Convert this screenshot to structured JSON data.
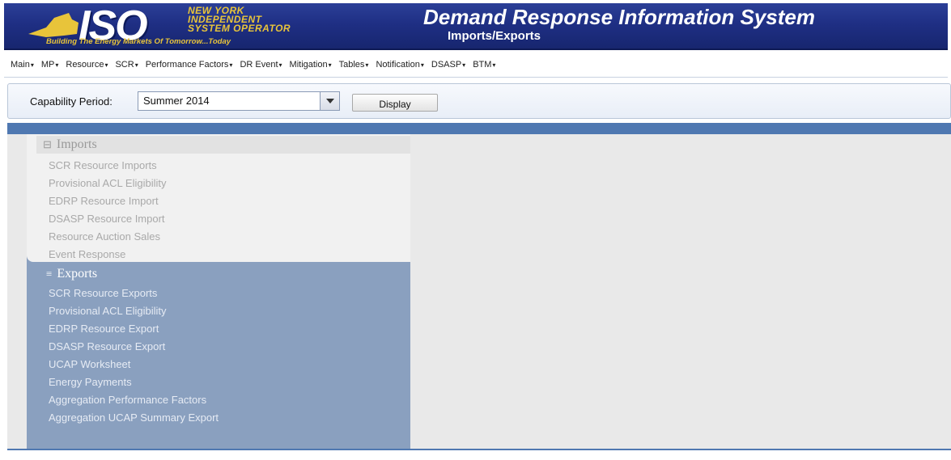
{
  "header": {
    "logo_text": "ISO",
    "org_lines": [
      "NEW YORK",
      "INDEPENDENT",
      "SYSTEM OPERATOR"
    ],
    "tagline": "Building The Energy Markets Of Tomorrow...Today",
    "app_title": "Demand Response Information System",
    "page_subtitle": "Imports/Exports",
    "brand_gold": "#e8c43a",
    "brand_blue": "#1f2f84"
  },
  "menu": {
    "items": [
      {
        "label": "Main"
      },
      {
        "label": "MP"
      },
      {
        "label": "Resource"
      },
      {
        "label": "SCR"
      },
      {
        "label": "Performance Factors"
      },
      {
        "label": "DR Event"
      },
      {
        "label": "Mitigation"
      },
      {
        "label": "Tables"
      },
      {
        "label": "Notification"
      },
      {
        "label": "DSASP"
      },
      {
        "label": "BTM"
      }
    ],
    "caret": "▾"
  },
  "capability": {
    "label": "Capability Period:",
    "selected": "Summer 2014",
    "dropdown_icon": "chevron-down-icon",
    "display_label": "Display"
  },
  "imports": {
    "title": "Imports",
    "icon": "collapse-icon",
    "items": [
      "SCR Resource Imports",
      "Provisional ACL Eligibility",
      "EDRP Resource Import",
      "DSASP Resource Import",
      "Resource Auction Sales",
      "Event Response"
    ]
  },
  "exports": {
    "title": "Exports",
    "icon": "collapse-icon",
    "items": [
      "SCR Resource Exports",
      "Provisional ACL Eligibility",
      "EDRP Resource Export",
      "DSASP Resource Export",
      "UCAP Worksheet",
      "Energy Payments",
      "Aggregation Performance Factors",
      "Aggregation UCAP Summary Export"
    ]
  }
}
